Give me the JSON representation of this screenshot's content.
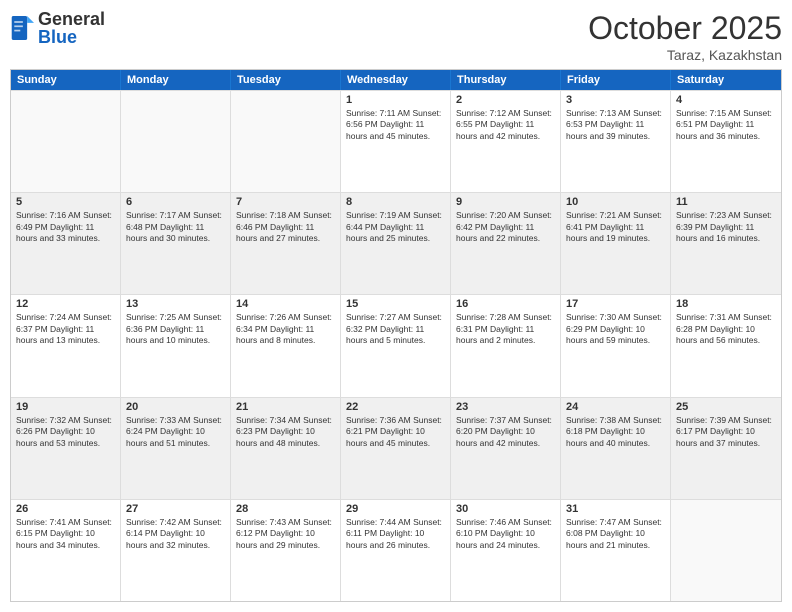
{
  "header": {
    "logo_general": "General",
    "logo_blue": "Blue",
    "month_title": "October 2025",
    "location": "Taraz, Kazakhstan"
  },
  "days_of_week": [
    "Sunday",
    "Monday",
    "Tuesday",
    "Wednesday",
    "Thursday",
    "Friday",
    "Saturday"
  ],
  "rows": [
    [
      {
        "day": "",
        "info": ""
      },
      {
        "day": "",
        "info": ""
      },
      {
        "day": "",
        "info": ""
      },
      {
        "day": "1",
        "info": "Sunrise: 7:11 AM\nSunset: 6:56 PM\nDaylight: 11 hours\nand 45 minutes."
      },
      {
        "day": "2",
        "info": "Sunrise: 7:12 AM\nSunset: 6:55 PM\nDaylight: 11 hours\nand 42 minutes."
      },
      {
        "day": "3",
        "info": "Sunrise: 7:13 AM\nSunset: 6:53 PM\nDaylight: 11 hours\nand 39 minutes."
      },
      {
        "day": "4",
        "info": "Sunrise: 7:15 AM\nSunset: 6:51 PM\nDaylight: 11 hours\nand 36 minutes."
      }
    ],
    [
      {
        "day": "5",
        "info": "Sunrise: 7:16 AM\nSunset: 6:49 PM\nDaylight: 11 hours\nand 33 minutes."
      },
      {
        "day": "6",
        "info": "Sunrise: 7:17 AM\nSunset: 6:48 PM\nDaylight: 11 hours\nand 30 minutes."
      },
      {
        "day": "7",
        "info": "Sunrise: 7:18 AM\nSunset: 6:46 PM\nDaylight: 11 hours\nand 27 minutes."
      },
      {
        "day": "8",
        "info": "Sunrise: 7:19 AM\nSunset: 6:44 PM\nDaylight: 11 hours\nand 25 minutes."
      },
      {
        "day": "9",
        "info": "Sunrise: 7:20 AM\nSunset: 6:42 PM\nDaylight: 11 hours\nand 22 minutes."
      },
      {
        "day": "10",
        "info": "Sunrise: 7:21 AM\nSunset: 6:41 PM\nDaylight: 11 hours\nand 19 minutes."
      },
      {
        "day": "11",
        "info": "Sunrise: 7:23 AM\nSunset: 6:39 PM\nDaylight: 11 hours\nand 16 minutes."
      }
    ],
    [
      {
        "day": "12",
        "info": "Sunrise: 7:24 AM\nSunset: 6:37 PM\nDaylight: 11 hours\nand 13 minutes."
      },
      {
        "day": "13",
        "info": "Sunrise: 7:25 AM\nSunset: 6:36 PM\nDaylight: 11 hours\nand 10 minutes."
      },
      {
        "day": "14",
        "info": "Sunrise: 7:26 AM\nSunset: 6:34 PM\nDaylight: 11 hours\nand 8 minutes."
      },
      {
        "day": "15",
        "info": "Sunrise: 7:27 AM\nSunset: 6:32 PM\nDaylight: 11 hours\nand 5 minutes."
      },
      {
        "day": "16",
        "info": "Sunrise: 7:28 AM\nSunset: 6:31 PM\nDaylight: 11 hours\nand 2 minutes."
      },
      {
        "day": "17",
        "info": "Sunrise: 7:30 AM\nSunset: 6:29 PM\nDaylight: 10 hours\nand 59 minutes."
      },
      {
        "day": "18",
        "info": "Sunrise: 7:31 AM\nSunset: 6:28 PM\nDaylight: 10 hours\nand 56 minutes."
      }
    ],
    [
      {
        "day": "19",
        "info": "Sunrise: 7:32 AM\nSunset: 6:26 PM\nDaylight: 10 hours\nand 53 minutes."
      },
      {
        "day": "20",
        "info": "Sunrise: 7:33 AM\nSunset: 6:24 PM\nDaylight: 10 hours\nand 51 minutes."
      },
      {
        "day": "21",
        "info": "Sunrise: 7:34 AM\nSunset: 6:23 PM\nDaylight: 10 hours\nand 48 minutes."
      },
      {
        "day": "22",
        "info": "Sunrise: 7:36 AM\nSunset: 6:21 PM\nDaylight: 10 hours\nand 45 minutes."
      },
      {
        "day": "23",
        "info": "Sunrise: 7:37 AM\nSunset: 6:20 PM\nDaylight: 10 hours\nand 42 minutes."
      },
      {
        "day": "24",
        "info": "Sunrise: 7:38 AM\nSunset: 6:18 PM\nDaylight: 10 hours\nand 40 minutes."
      },
      {
        "day": "25",
        "info": "Sunrise: 7:39 AM\nSunset: 6:17 PM\nDaylight: 10 hours\nand 37 minutes."
      }
    ],
    [
      {
        "day": "26",
        "info": "Sunrise: 7:41 AM\nSunset: 6:15 PM\nDaylight: 10 hours\nand 34 minutes."
      },
      {
        "day": "27",
        "info": "Sunrise: 7:42 AM\nSunset: 6:14 PM\nDaylight: 10 hours\nand 32 minutes."
      },
      {
        "day": "28",
        "info": "Sunrise: 7:43 AM\nSunset: 6:12 PM\nDaylight: 10 hours\nand 29 minutes."
      },
      {
        "day": "29",
        "info": "Sunrise: 7:44 AM\nSunset: 6:11 PM\nDaylight: 10 hours\nand 26 minutes."
      },
      {
        "day": "30",
        "info": "Sunrise: 7:46 AM\nSunset: 6:10 PM\nDaylight: 10 hours\nand 24 minutes."
      },
      {
        "day": "31",
        "info": "Sunrise: 7:47 AM\nSunset: 6:08 PM\nDaylight: 10 hours\nand 21 minutes."
      },
      {
        "day": "",
        "info": ""
      }
    ]
  ]
}
